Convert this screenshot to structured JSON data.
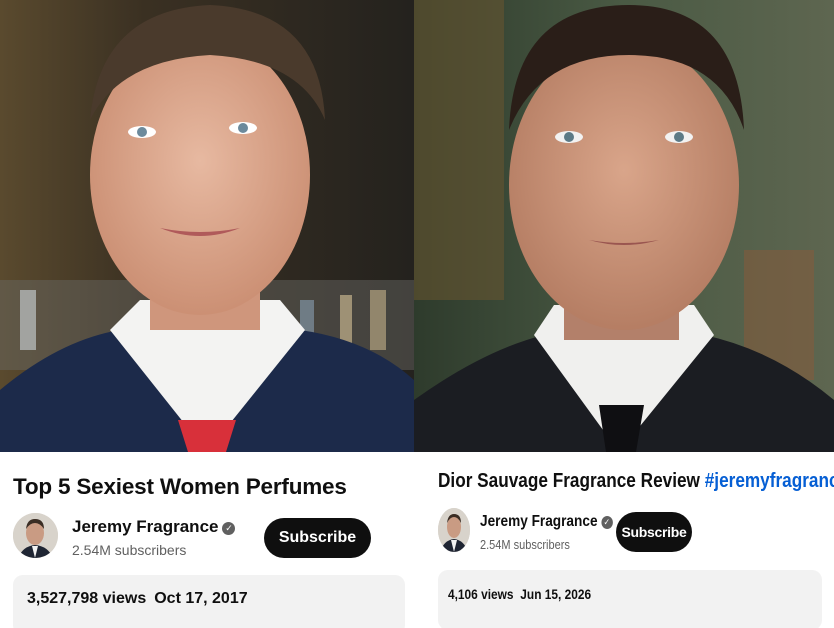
{
  "left": {
    "title": "Top 5 Sexiest Women Perfumes",
    "channel": "Jeremy Fragrance",
    "subscribers": "2.54M subscribers",
    "subscribe_label": "Subscribe",
    "views": "3,527,798 views",
    "date": "Oct 17, 2017"
  },
  "right": {
    "title_text": "Dior Sauvage Fragrance Review ",
    "hashtags": "#jeremyfragrance #f",
    "channel": "Jeremy Fragrance",
    "subscribers": "2.54M subscribers",
    "subscribe_label": "Subscribe",
    "views": "4,106 views",
    "date": "Jun 15, 2026"
  },
  "icons": {
    "verified": "verified-checkmark-icon"
  },
  "colors": {
    "subscribe_bg": "#0f0f0f",
    "hashtag": "#065fd4",
    "meta_gray": "#606060",
    "info_bg": "#f2f2f2"
  }
}
